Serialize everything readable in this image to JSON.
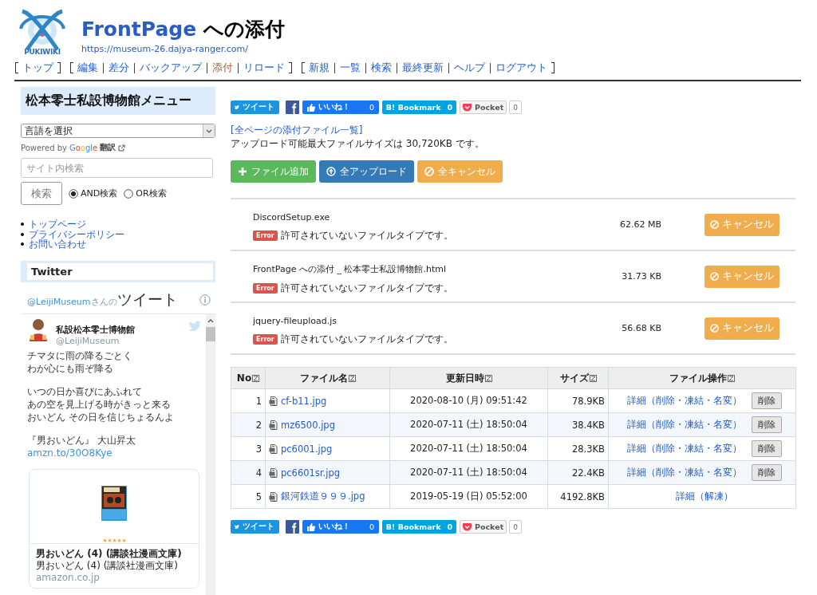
{
  "logo": {
    "text": "PUKIWIKI"
  },
  "title": {
    "page": "FrontPage",
    "rest": "への添付"
  },
  "site_url": "https://museum-26.dajya-ranger.com/",
  "nav": {
    "groups": [
      {
        "items": [
          {
            "label": "トップ",
            "current": false
          }
        ]
      },
      {
        "items": [
          {
            "label": "編集",
            "current": false
          },
          {
            "label": "差分",
            "current": false
          },
          {
            "label": "バックアップ",
            "current": false
          },
          {
            "label": "添付",
            "current": true
          },
          {
            "label": "リロード",
            "current": false
          }
        ]
      },
      {
        "items": [
          {
            "label": "新規",
            "current": false
          },
          {
            "label": "一覧",
            "current": false
          },
          {
            "label": "検索",
            "current": false
          },
          {
            "label": "最終更新",
            "current": false
          },
          {
            "label": "ヘルプ",
            "current": false
          },
          {
            "label": "ログアウト",
            "current": false
          }
        ]
      }
    ]
  },
  "sidebar": {
    "menu_title": "松本零士私設博物館メニュー",
    "language_select": {
      "value": "言語を選択"
    },
    "translate": {
      "powered_by": "Powered by",
      "brand": "Google",
      "label": "翻訳"
    },
    "search": {
      "placeholder": "サイト内検索",
      "button": "検索",
      "modes": [
        {
          "label": "AND検索",
          "selected": true
        },
        {
          "label": "OR検索",
          "selected": false
        }
      ]
    },
    "links": [
      "トップページ",
      "プライバシーポリシー",
      "お問い合わせ"
    ],
    "twitter_heading": "Twitter",
    "timeline": {
      "handle": "@LeijiMuseum",
      "handle_suffix": "さんの",
      "title": "ツイート",
      "tweet": {
        "name": "私設松本零士博物館",
        "handle": "@LeijiMuseum",
        "paragraphs": [
          [
            "チマタに雨の降るごとく",
            "わが心にも雨ぞ降る"
          ],
          [
            "いつの日か喜びにあふれて",
            "あの空を見上げる時がきっと来る",
            "おいどん その日を信じちょるんよ"
          ]
        ],
        "source": "『男おいどん』 大山昇太",
        "link": "amzn.to/30O8Kye",
        "card": {
          "stars": 5,
          "title": "男おいどん (4) (講談社漫画文庫)",
          "subtitle": "男おいどん (4) (講談社漫画文庫)",
          "domain": "amazon.co.jp"
        }
      }
    }
  },
  "share_bars": [
    {
      "tweet": "ツイート",
      "like": "いいね！",
      "like_count": "0",
      "bookmark": "B! Bookmark",
      "bookmark_count": "0",
      "pocket": "Pocket",
      "pocket_count": "0"
    },
    {
      "tweet": "ツイート",
      "like": "いいね！",
      "like_count": "0",
      "bookmark": "B! Bookmark",
      "bookmark_count": "0",
      "pocket": "Pocket",
      "pocket_count": "0"
    }
  ],
  "attachments_link": "[全ページの添付ファイル一覧]",
  "max_size_note": "アップロード可能最大ファイルサイズは 30,720KB です。",
  "upload_buttons": [
    {
      "kind": "add",
      "label": "ファイル追加"
    },
    {
      "kind": "upload",
      "label": "全アップロード"
    },
    {
      "kind": "cancel",
      "label": "全キャンセル"
    }
  ],
  "uploads": [
    {
      "name": "DiscordSetup.exe",
      "size": "62.62 MB",
      "badge": "Error",
      "message": "許可されていないファイルタイプです。",
      "cancel": "キャンセル"
    },
    {
      "name": "FrontPage への添付 _ 松本零士私設博物館.html",
      "size": "31.73 KB",
      "badge": "Error",
      "message": "許可されていないファイルタイプです。",
      "cancel": "キャンセル"
    },
    {
      "name": "jquery-fileupload.js",
      "size": "56.68 KB",
      "badge": "Error",
      "message": "許可されていないファイルタイプです。",
      "cancel": "キャンセル"
    }
  ],
  "table": {
    "columns": [
      "No",
      "ファイル名",
      "更新日時",
      "サイズ",
      "ファイル操作"
    ],
    "rows": [
      {
        "no": "1",
        "name": "cf-b11.jpg",
        "date": "2020-08-10 (月) 09:51:42",
        "size": "78.9KB",
        "detail": "詳細（削除・凍結・名変）",
        "delete": "削除"
      },
      {
        "no": "2",
        "name": "mz6500.jpg",
        "date": "2020-07-11 (土) 18:50:04",
        "size": "38.4KB",
        "detail": "詳細（削除・凍結・名変）",
        "delete": "削除"
      },
      {
        "no": "3",
        "name": "pc6001.jpg",
        "date": "2020-07-11 (土) 18:50:04",
        "size": "28.3KB",
        "detail": "詳細（削除・凍結・名変）",
        "delete": "削除"
      },
      {
        "no": "4",
        "name": "pc6601sr.jpg",
        "date": "2020-07-11 (土) 18:50:04",
        "size": "22.4KB",
        "detail": "詳細（削除・凍結・名変）",
        "delete": "削除"
      },
      {
        "no": "5",
        "name": "銀河鉄道９９９.jpg",
        "date": "2019-05-19 (日) 05:52:00",
        "size": "4192.8KB",
        "detail": "詳細（解凍）"
      }
    ]
  }
}
